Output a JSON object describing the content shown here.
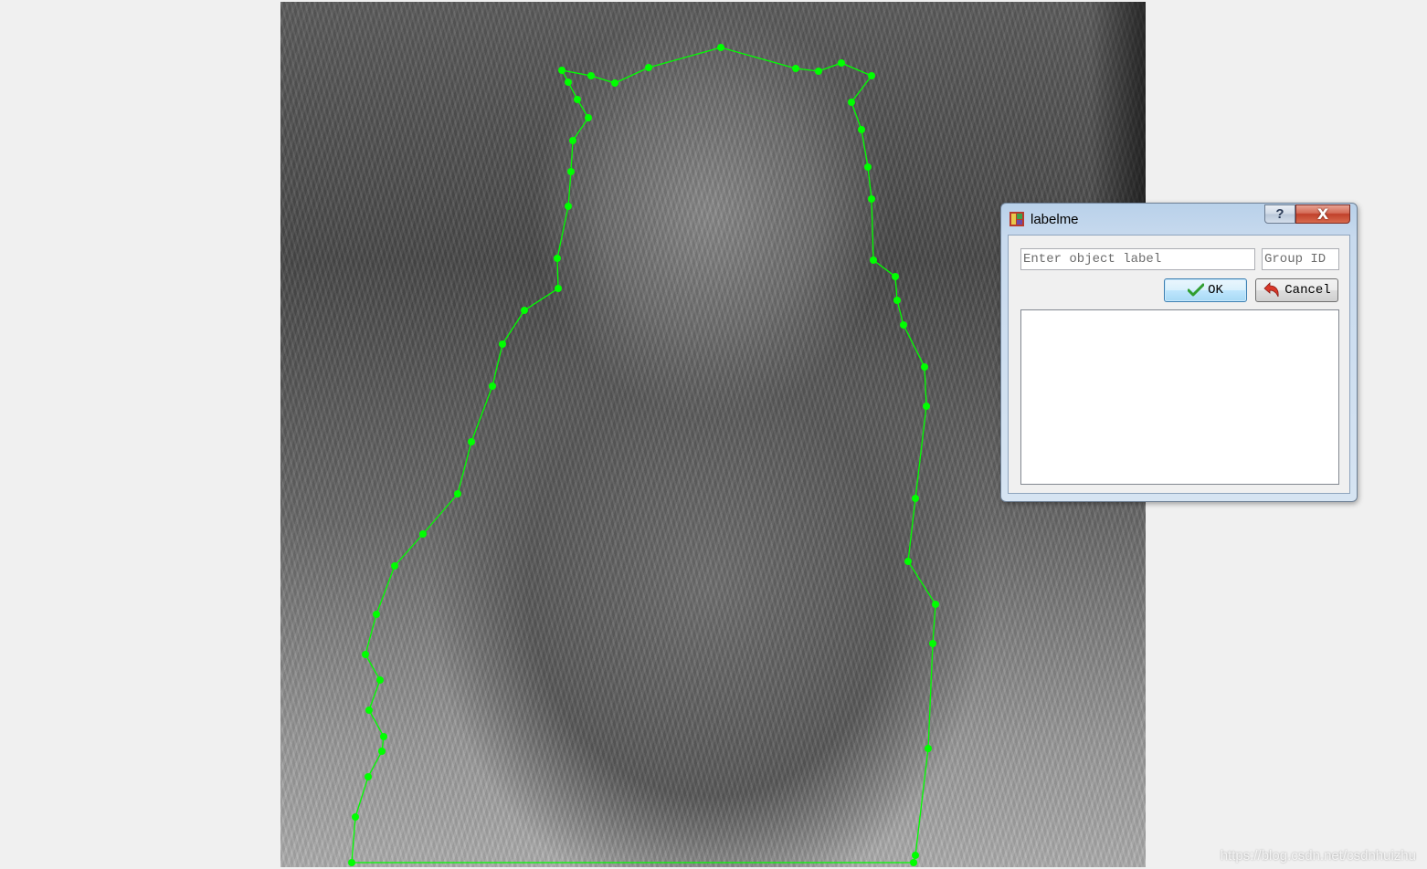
{
  "dialog": {
    "title": "labelme",
    "help_label": "?",
    "close_label": "X",
    "label_placeholder": "Enter object label",
    "group_id_placeholder": "Group ID",
    "ok_label": "OK",
    "cancel_label": "Cancel",
    "label_list_items": []
  },
  "canvas": {
    "polygon_color": "#00ff00"
  },
  "watermark": "https://blog.csdn.net/csdnhuizhu",
  "icons": {
    "app": "labelme-app-icon",
    "ok": "green-checkmark-icon",
    "cancel": "red-undo-arrow-icon"
  }
}
